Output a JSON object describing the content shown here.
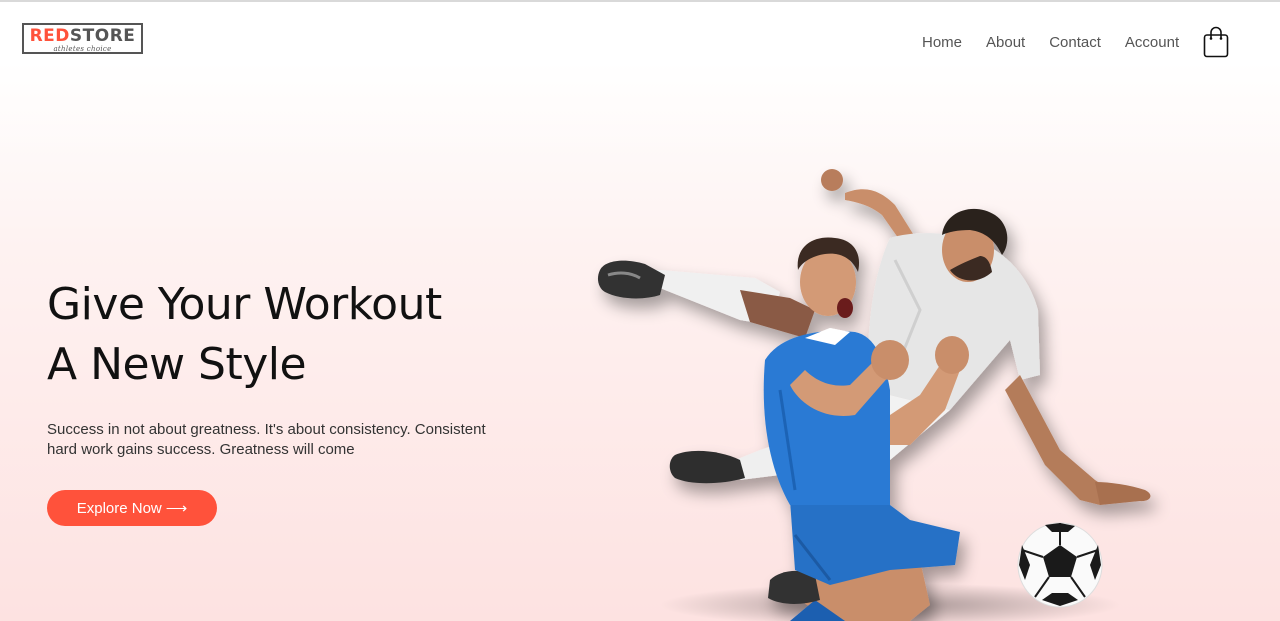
{
  "header": {
    "logo": {
      "brand_red": "RED",
      "brand_dark": "STORE",
      "tagline": "athletes choice",
      "accent_color": "#ff523b"
    },
    "nav": [
      {
        "label": "Home"
      },
      {
        "label": "About"
      },
      {
        "label": "Contact"
      },
      {
        "label": "Account"
      }
    ],
    "cart_icon": "shopping-bag-icon"
  },
  "hero": {
    "headline_line1": "Give Your Workout",
    "headline_line2": "A New Style",
    "subtext": "Success in not about greatness. It's about consistency. Consistent hard work gains success. Greatness will come",
    "cta_label": "Explore Now",
    "cta_arrow": "⟶",
    "cta_color": "#ff523b",
    "image_subject": "soccer-players-celebrating-image"
  }
}
